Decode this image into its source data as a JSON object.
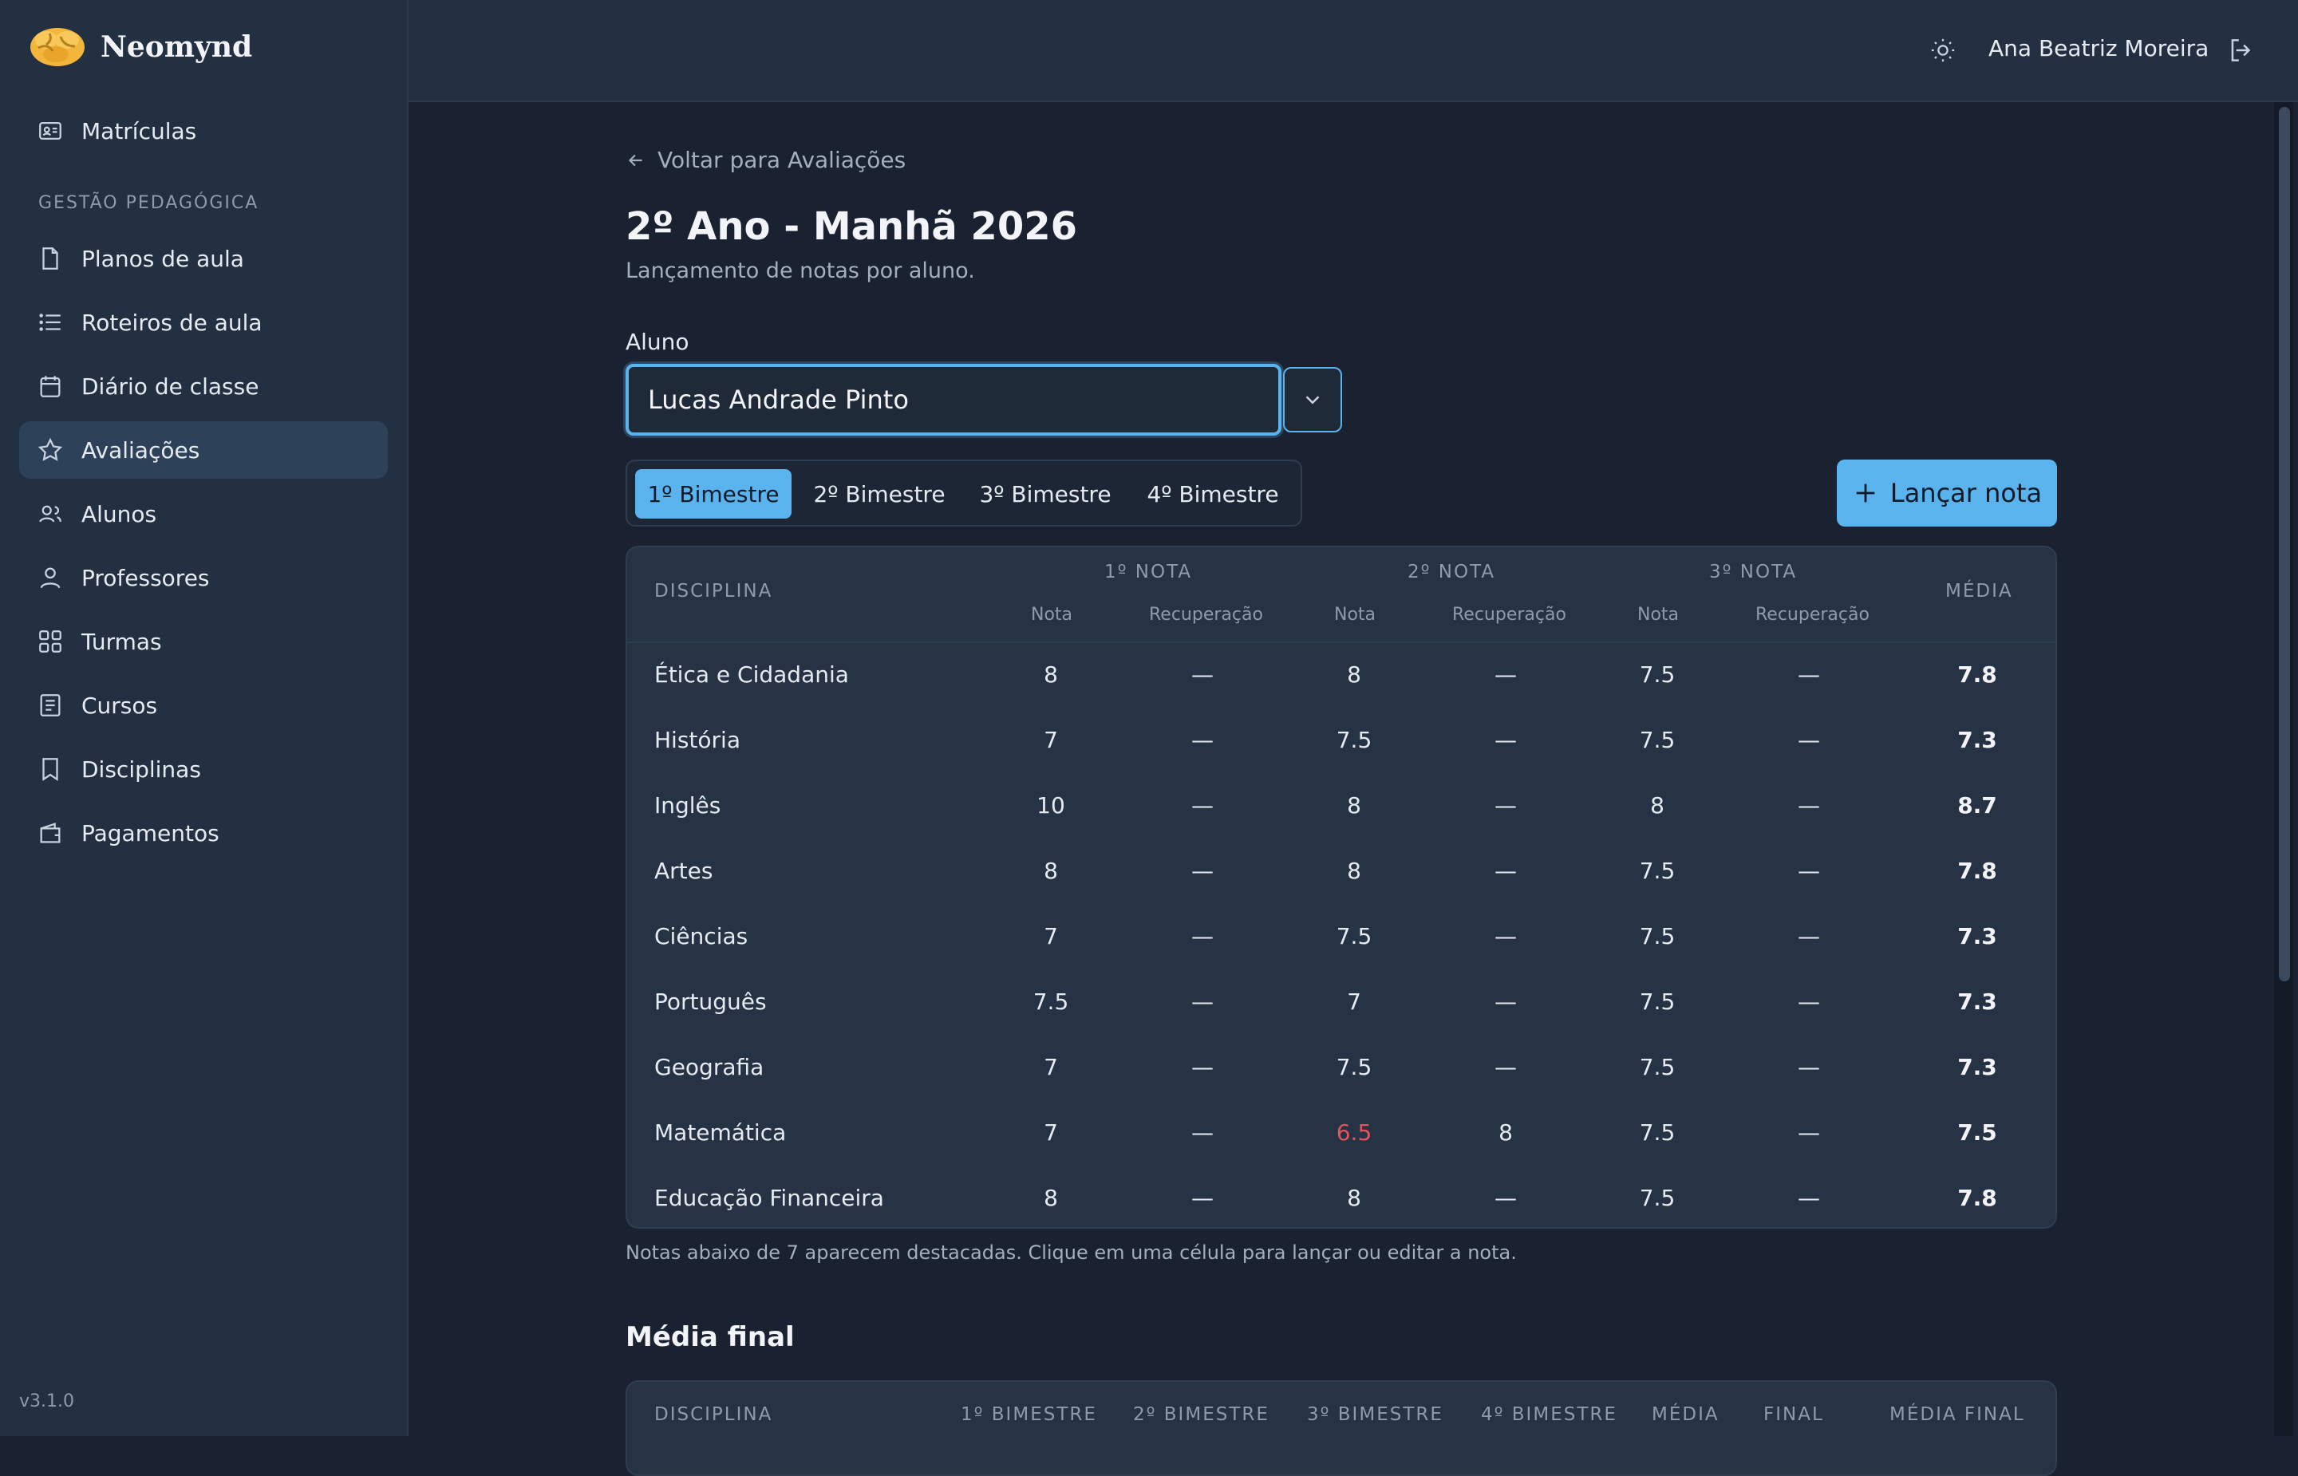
{
  "app": {
    "name": "Neomynd",
    "version": "v3.1.0"
  },
  "sidebar": {
    "top_item": {
      "label": "Matrículas",
      "icon": "id-card-icon"
    },
    "section_title": "GESTÃO PEDAGÓGICA",
    "items": [
      {
        "label": "Planos de aula",
        "icon": "file-icon"
      },
      {
        "label": "Roteiros de aula",
        "icon": "list-icon"
      },
      {
        "label": "Diário de classe",
        "icon": "calendar-icon"
      },
      {
        "label": "Avaliações",
        "icon": "star-icon",
        "active": true
      },
      {
        "label": "Alunos",
        "icon": "users-icon"
      },
      {
        "label": "Professores",
        "icon": "user-icon"
      },
      {
        "label": "Turmas",
        "icon": "grid-icon"
      },
      {
        "label": "Cursos",
        "icon": "notebook-icon"
      },
      {
        "label": "Disciplinas",
        "icon": "bookmark-icon"
      },
      {
        "label": "Pagamentos",
        "icon": "wallet-icon"
      }
    ]
  },
  "header": {
    "user_name": "Ana Beatriz Moreira"
  },
  "page": {
    "back_label": "Voltar para Avaliações",
    "title": "2º Ano - Manhã 2026",
    "subtitle": "Lançamento de notas por aluno.",
    "student_label": "Aluno",
    "student_value": "Lucas Andrade Pinto",
    "tabs": [
      "1º Bimestre",
      "2º Bimestre",
      "3º Bimestre",
      "4º Bimestre"
    ],
    "active_tab": 0,
    "launch_button": "Lançar nota",
    "note": "Notas abaixo de 7 aparecem destacadas. Clique em uma célula para lançar ou editar a nota."
  },
  "grades_table": {
    "headers": {
      "discipline": "DISCIPLINA",
      "group1": "1º NOTA",
      "group2": "2º NOTA",
      "group3": "3º NOTA",
      "average": "MÉDIA",
      "nota": "Nota",
      "recuperacao": "Recuperação"
    },
    "rows": [
      {
        "discipline": "Ética e Cidadania",
        "n1": "8",
        "r1": "—",
        "n2": "8",
        "r2": "—",
        "n3": "7.5",
        "r3": "—",
        "media": "7.8"
      },
      {
        "discipline": "História",
        "n1": "7",
        "r1": "—",
        "n2": "7.5",
        "r2": "—",
        "n3": "7.5",
        "r3": "—",
        "media": "7.3"
      },
      {
        "discipline": "Inglês",
        "n1": "10",
        "r1": "—",
        "n2": "8",
        "r2": "—",
        "n3": "8",
        "r3": "—",
        "media": "8.7"
      },
      {
        "discipline": "Artes",
        "n1": "8",
        "r1": "—",
        "n2": "8",
        "r2": "—",
        "n3": "7.5",
        "r3": "—",
        "media": "7.8"
      },
      {
        "discipline": "Ciências",
        "n1": "7",
        "r1": "—",
        "n2": "7.5",
        "r2": "—",
        "n3": "7.5",
        "r3": "—",
        "media": "7.3"
      },
      {
        "discipline": "Português",
        "n1": "7.5",
        "r1": "—",
        "n2": "7",
        "r2": "—",
        "n3": "7.5",
        "r3": "—",
        "media": "7.3"
      },
      {
        "discipline": "Geografia",
        "n1": "7",
        "r1": "—",
        "n2": "7.5",
        "r2": "—",
        "n3": "7.5",
        "r3": "—",
        "media": "7.3"
      },
      {
        "discipline": "Matemática",
        "n1": "7",
        "r1": "—",
        "n2": "6.5",
        "r2": "8",
        "n3": "7.5",
        "r3": "—",
        "media": "7.5",
        "low": [
          "n2"
        ]
      },
      {
        "discipline": "Educação Financeira",
        "n1": "8",
        "r1": "—",
        "n2": "8",
        "r2": "—",
        "n3": "7.5",
        "r3": "—",
        "media": "7.8"
      }
    ]
  },
  "final_section": {
    "title": "Média final",
    "headers": [
      "DISCIPLINA",
      "1º BIMESTRE",
      "2º BIMESTRE",
      "3º BIMESTRE",
      "4º BIMESTRE",
      "MÉDIA",
      "FINAL",
      "MÉDIA FINAL"
    ]
  },
  "colors": {
    "accent": "#5bb3ee",
    "low_grade": "#e2555a",
    "background": "#1a2231",
    "sidebar": "#223041"
  }
}
